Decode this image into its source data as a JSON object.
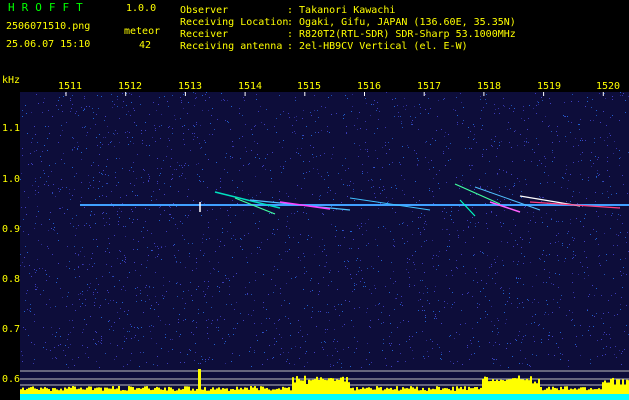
{
  "app": {
    "name": "HROFFT",
    "version": "1.0.0"
  },
  "file": {
    "name": "2506071510.png",
    "datetime": "25.06.07 15:10"
  },
  "meteor": {
    "label": "meteor",
    "count": "42"
  },
  "info": [
    {
      "label": "Observer",
      "value": ": Takanori Kawachi"
    },
    {
      "label": "Receiving Location",
      "value": ": Ogaki, Gifu, JAPAN (136.60E, 35.35N)"
    },
    {
      "label": "Receiver",
      "value": ": R820T2(RTL-SDR) SDR-Sharp 53.1000MHz"
    },
    {
      "label": "Receiving antenna",
      "value": ": 2el-HB9CV Vertical (el. E-W)"
    }
  ],
  "axis": {
    "unit": "kHz",
    "x_ticks": [
      "1511",
      "1512",
      "1513",
      "1514",
      "1515",
      "1516",
      "1517",
      "1518",
      "1519",
      "1520"
    ],
    "y_ticks": [
      "1.1",
      "1.0",
      "0.9",
      "0.8",
      "0.7",
      "0.6"
    ]
  },
  "colors": {
    "text": "#ffff00",
    "title": "#00ff00",
    "trace": "#40a0ff",
    "bar": "#ffff00",
    "base": "#00ffff"
  }
}
